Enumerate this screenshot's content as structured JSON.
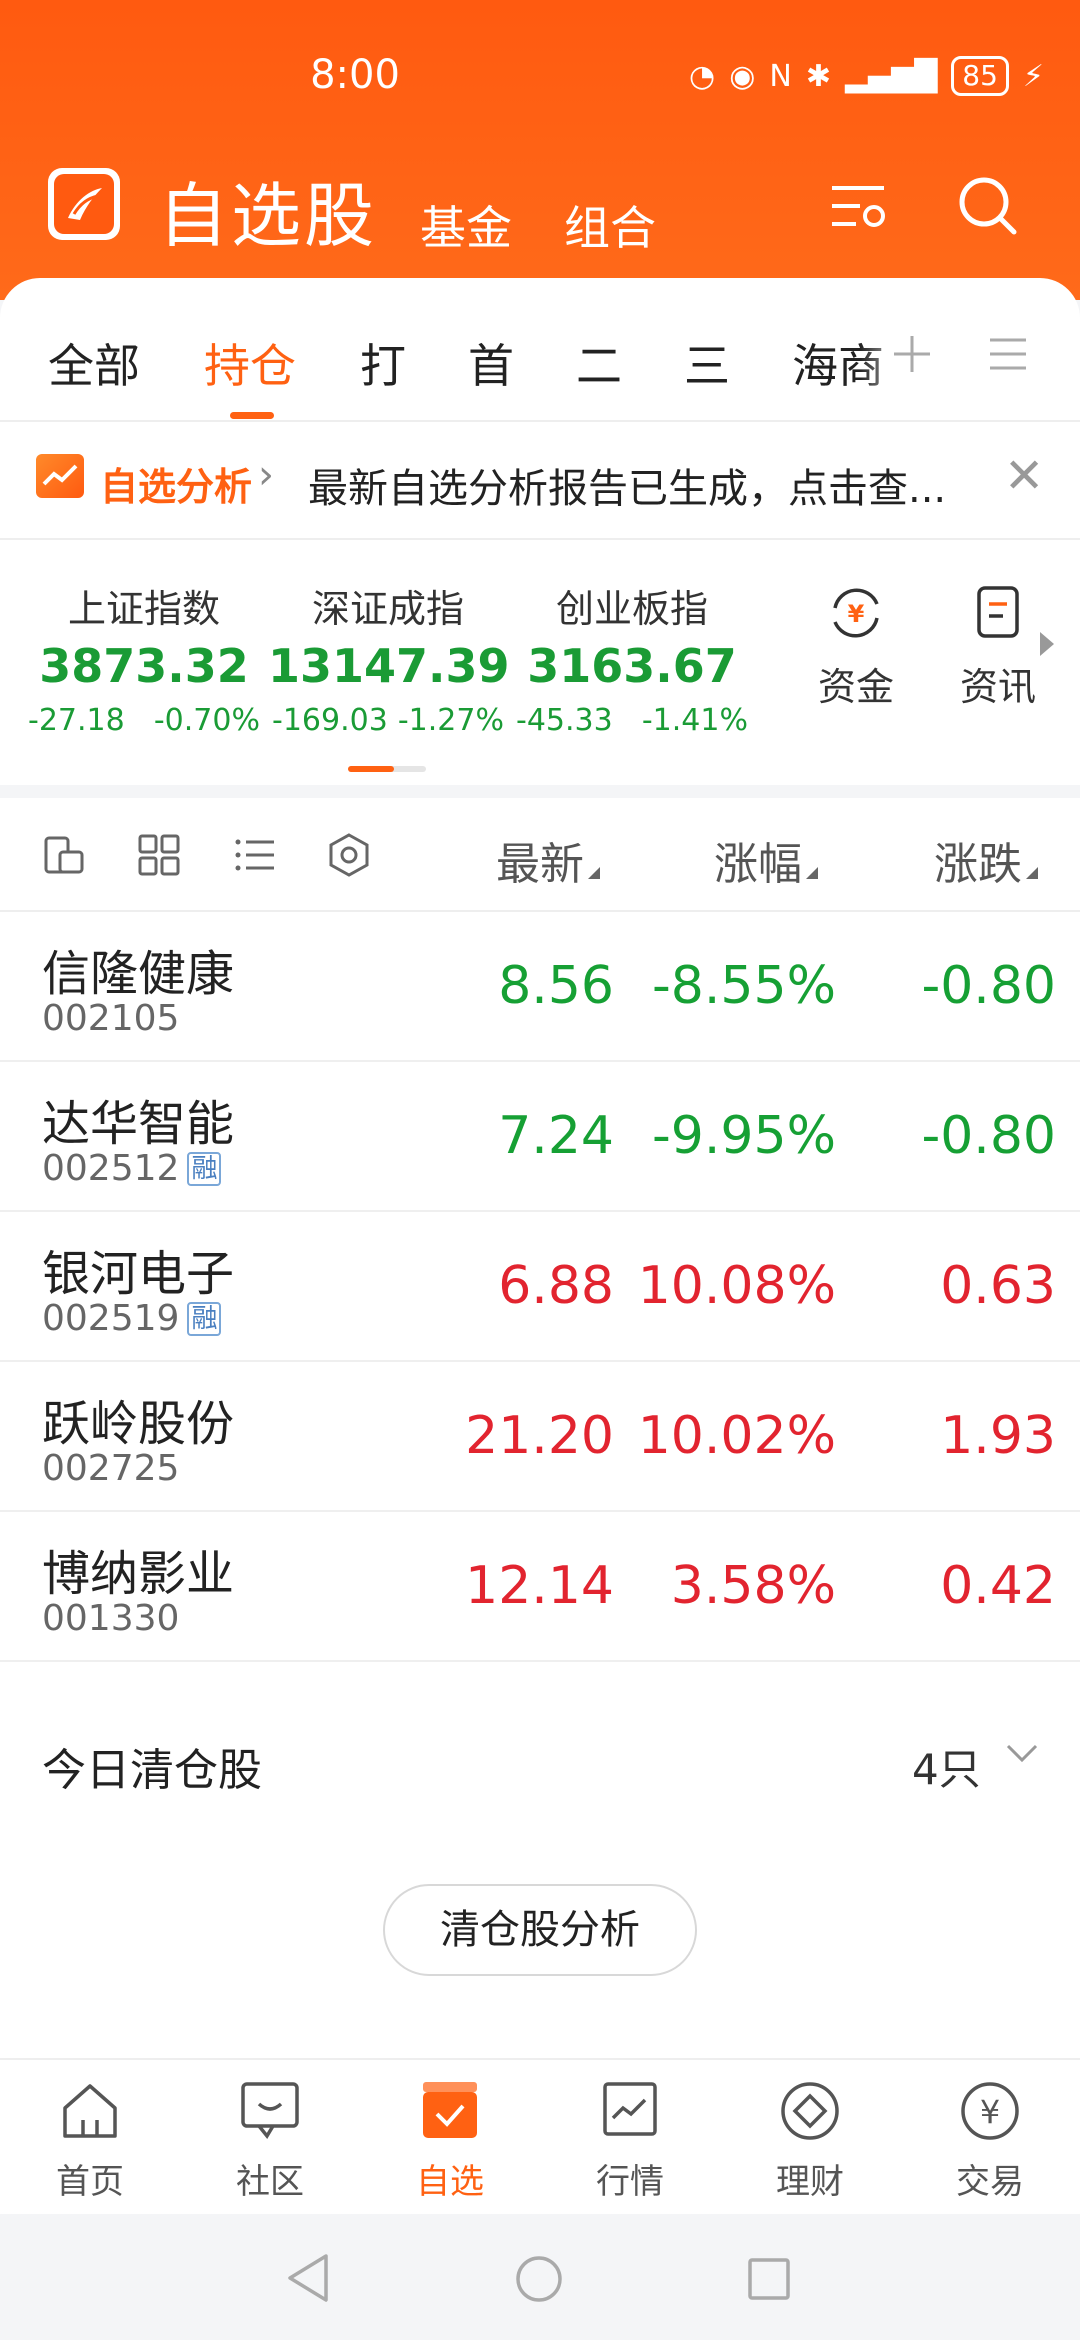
{
  "status_bar": {
    "time": "8:00",
    "battery": "85"
  },
  "header": {
    "title": "自选股",
    "tabs": [
      "基金",
      "组合"
    ]
  },
  "group_tabs": [
    "全部",
    "持仓",
    "打",
    "首",
    "二",
    "三",
    "海商"
  ],
  "active_group_tab": "持仓",
  "banner": {
    "label": "自选分析",
    "text": "最新自选分析报告已生成，点击查..."
  },
  "indices": [
    {
      "name": "上证指数",
      "value": "3873.32",
      "change": "-27.18",
      "pct": "-0.70%"
    },
    {
      "name": "深证成指",
      "value": "13147.39",
      "change": "-169.03",
      "pct": "-1.27%"
    },
    {
      "name": "创业板指",
      "value": "3163.67",
      "change": "-45.33",
      "pct": "-1.41%"
    }
  ],
  "quick_links": [
    {
      "label": "资金",
      "icon": "yuan-refresh-icon"
    },
    {
      "label": "资讯",
      "icon": "document-icon"
    }
  ],
  "list_columns": {
    "latest": "最新",
    "pct": "涨幅",
    "change": "涨跌"
  },
  "stocks": [
    {
      "name": "信隆健康",
      "code": "002105",
      "tag": "",
      "price": "8.56",
      "pct": "-8.55%",
      "change": "-0.80",
      "color": "#16a034"
    },
    {
      "name": "达华智能",
      "code": "002512",
      "tag": "融",
      "price": "7.24",
      "pct": "-9.95%",
      "change": "-0.80",
      "color": "#16a034"
    },
    {
      "name": "银河电子",
      "code": "002519",
      "tag": "融",
      "price": "6.88",
      "pct": "10.08%",
      "change": "0.63",
      "color": "#e2242f"
    },
    {
      "name": "跃岭股份",
      "code": "002725",
      "tag": "",
      "price": "21.20",
      "pct": "10.02%",
      "change": "1.93",
      "color": "#e2242f"
    },
    {
      "name": "博纳影业",
      "code": "001330",
      "tag": "",
      "price": "12.14",
      "pct": "3.58%",
      "change": "0.42",
      "color": "#e2242f"
    }
  ],
  "cleared": {
    "label": "今日清仓股",
    "count": "4只"
  },
  "analyze_button": "清仓股分析",
  "bottom_nav": [
    {
      "label": "首页",
      "icon": "home-icon"
    },
    {
      "label": "社区",
      "icon": "chat-icon"
    },
    {
      "label": "自选",
      "icon": "watchlist-icon"
    },
    {
      "label": "行情",
      "icon": "chart-icon"
    },
    {
      "label": "理财",
      "icon": "diamond-icon"
    },
    {
      "label": "交易",
      "icon": "yuan-circle-icon"
    }
  ],
  "colors": {
    "accent": "#ff6112",
    "down": "#16a034",
    "up": "#e2242f"
  }
}
